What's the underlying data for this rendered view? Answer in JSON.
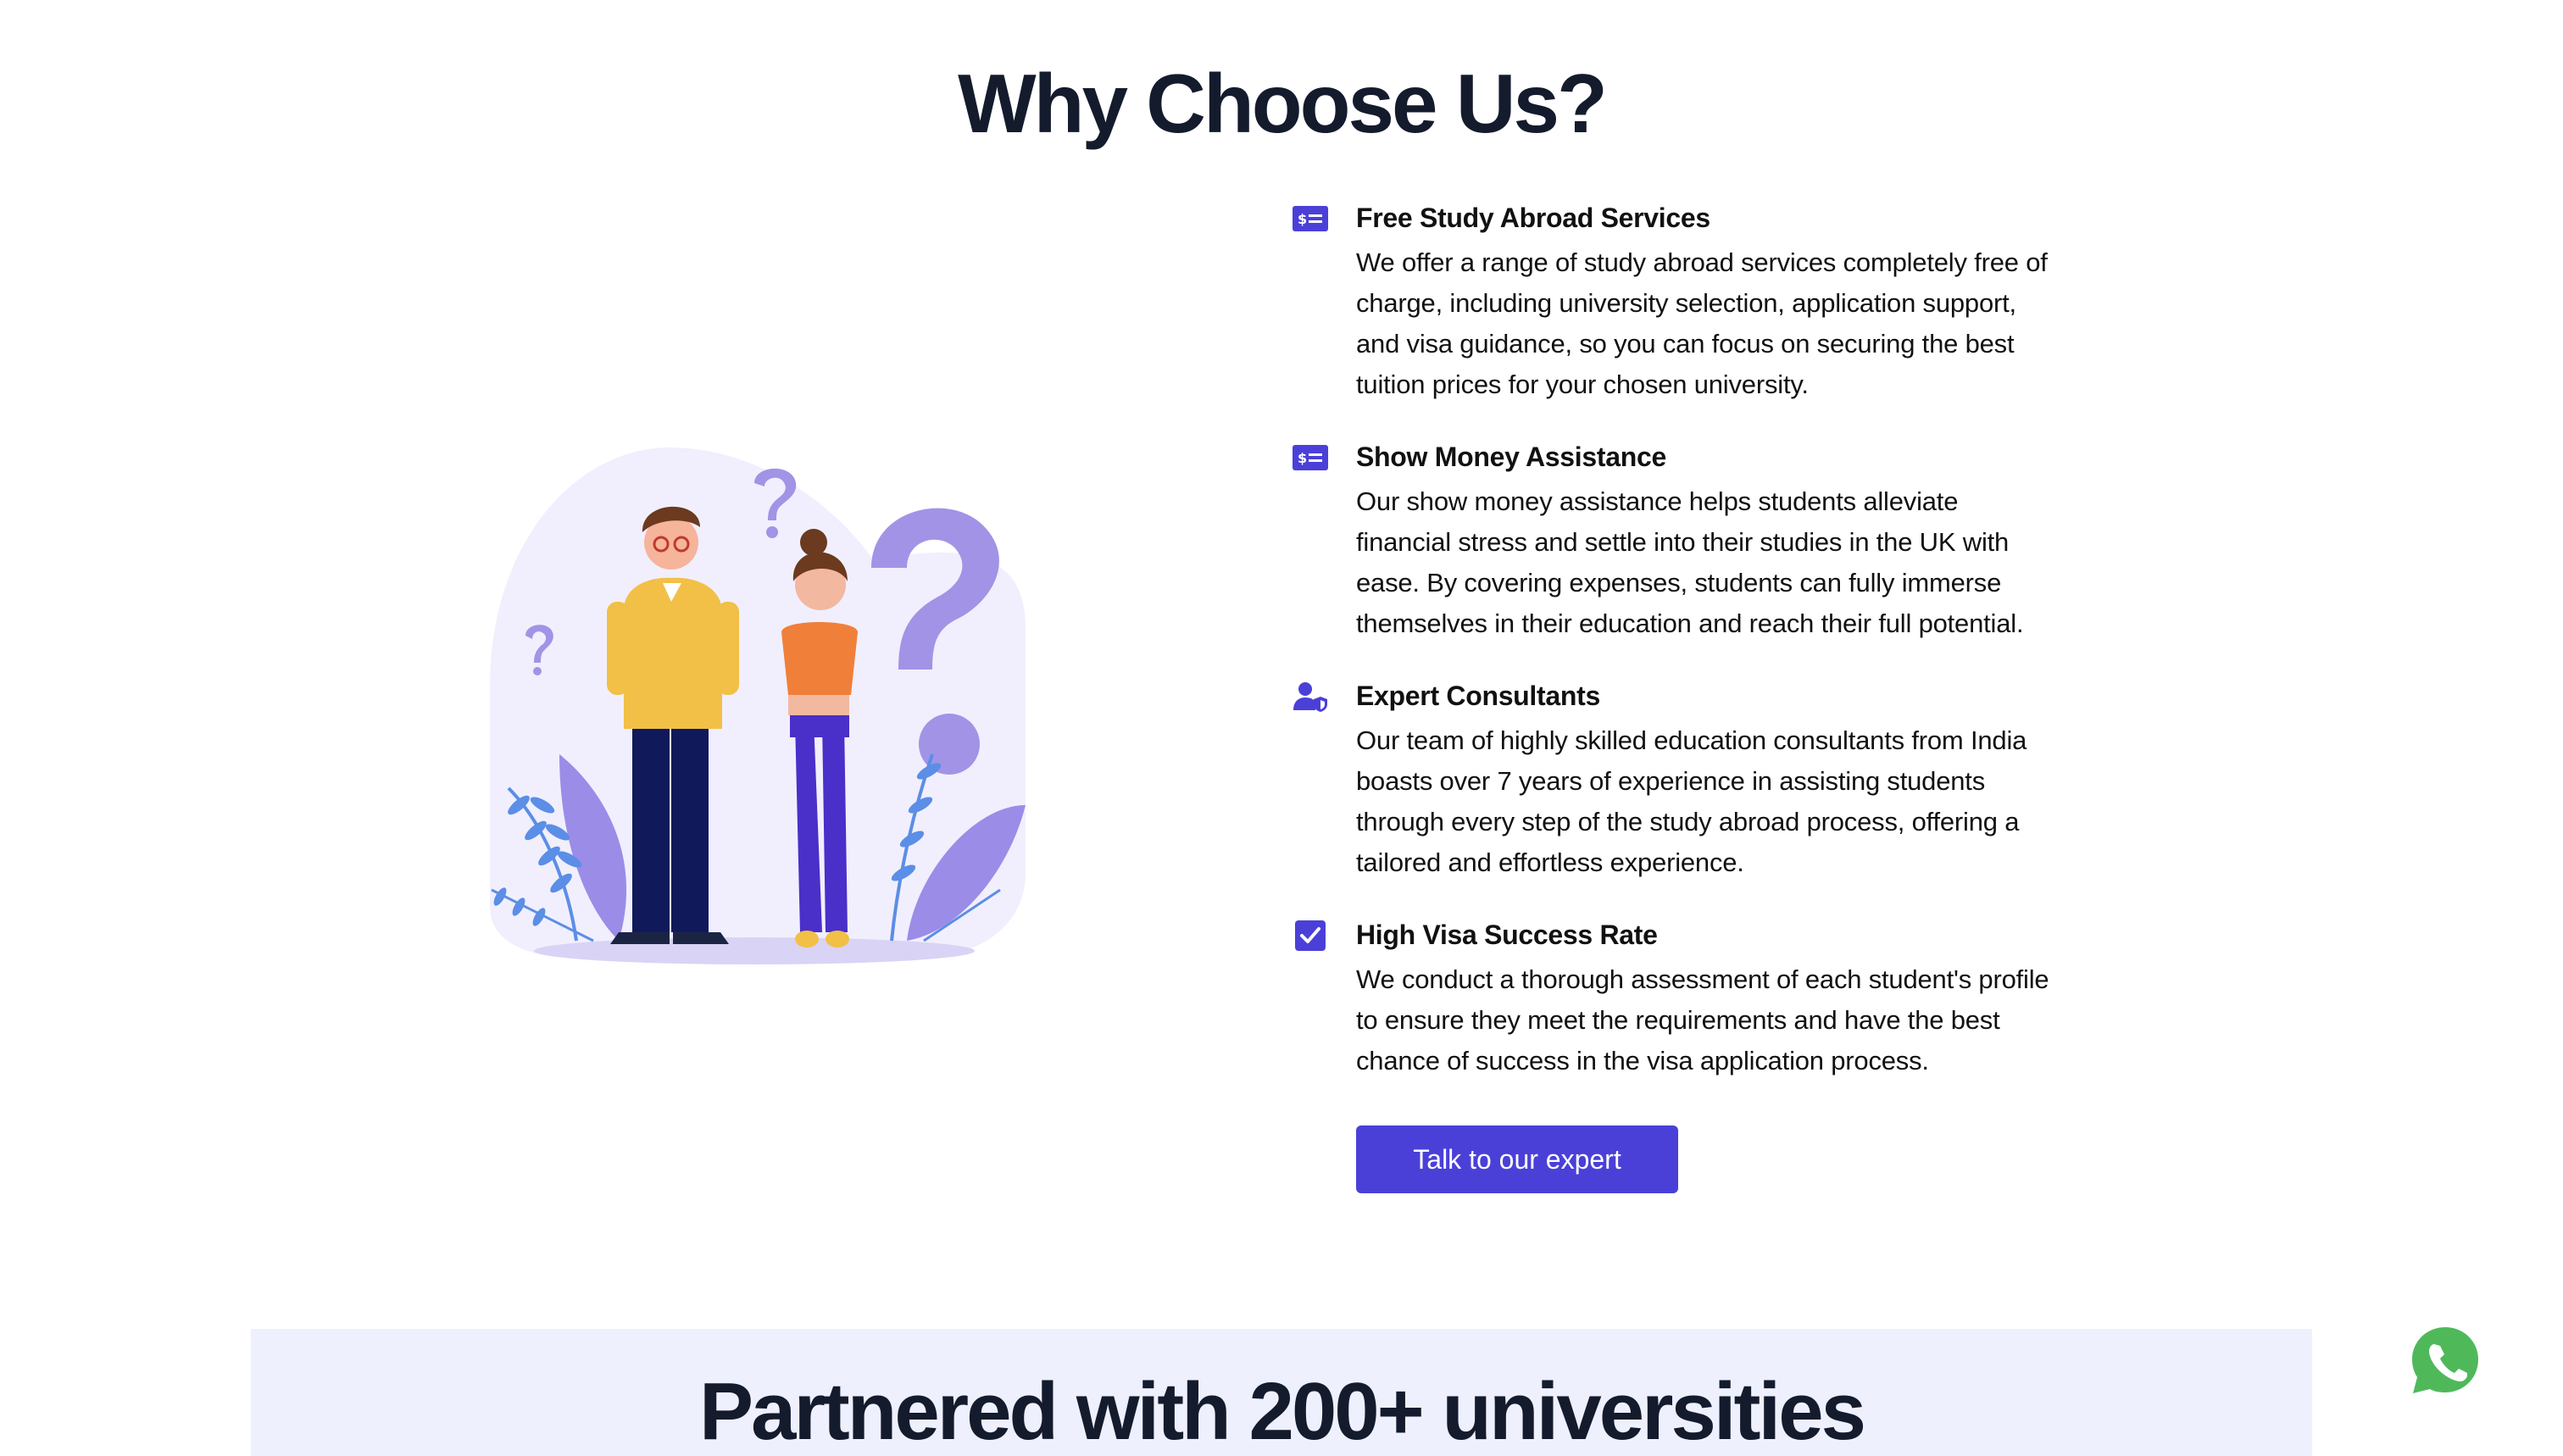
{
  "section": {
    "title": "Why Choose Us?"
  },
  "illustration": {
    "alt": ""
  },
  "features": [
    {
      "icon": "money-card-icon",
      "title": "Free Study Abroad Services",
      "text": "We offer a range of study abroad services completely free of charge, including university selection, application support, and visa guidance, so you can focus on securing the best tuition prices for your chosen university."
    },
    {
      "icon": "money-card-icon",
      "title": "Show Money Assistance",
      "text": "Our show money assistance helps students alleviate financial stress and settle into their studies in the UK with ease. By covering expenses, students can fully immerse themselves in their education and reach their full potential."
    },
    {
      "icon": "user-shield-icon",
      "title": "Expert Consultants",
      "text": "Our team of highly skilled education consultants from India boasts over 7 years of experience in assisting students through every step of the study abroad process, offering a tailored and effortless experience."
    },
    {
      "icon": "checkbox-icon",
      "title": "High Visa Success Rate",
      "text": "We conduct a thorough assessment of each student's profile to ensure they meet the requirements and have the best chance of success in the visa application process."
    }
  ],
  "cta": {
    "label": "Talk to our expert"
  },
  "partners": {
    "title": "Partnered with 200+ universities"
  },
  "colors": {
    "accent": "#4a40d8",
    "heading": "#141b2d",
    "whatsapp": "#4fb95a",
    "partners_bg": "#eef0fd"
  }
}
